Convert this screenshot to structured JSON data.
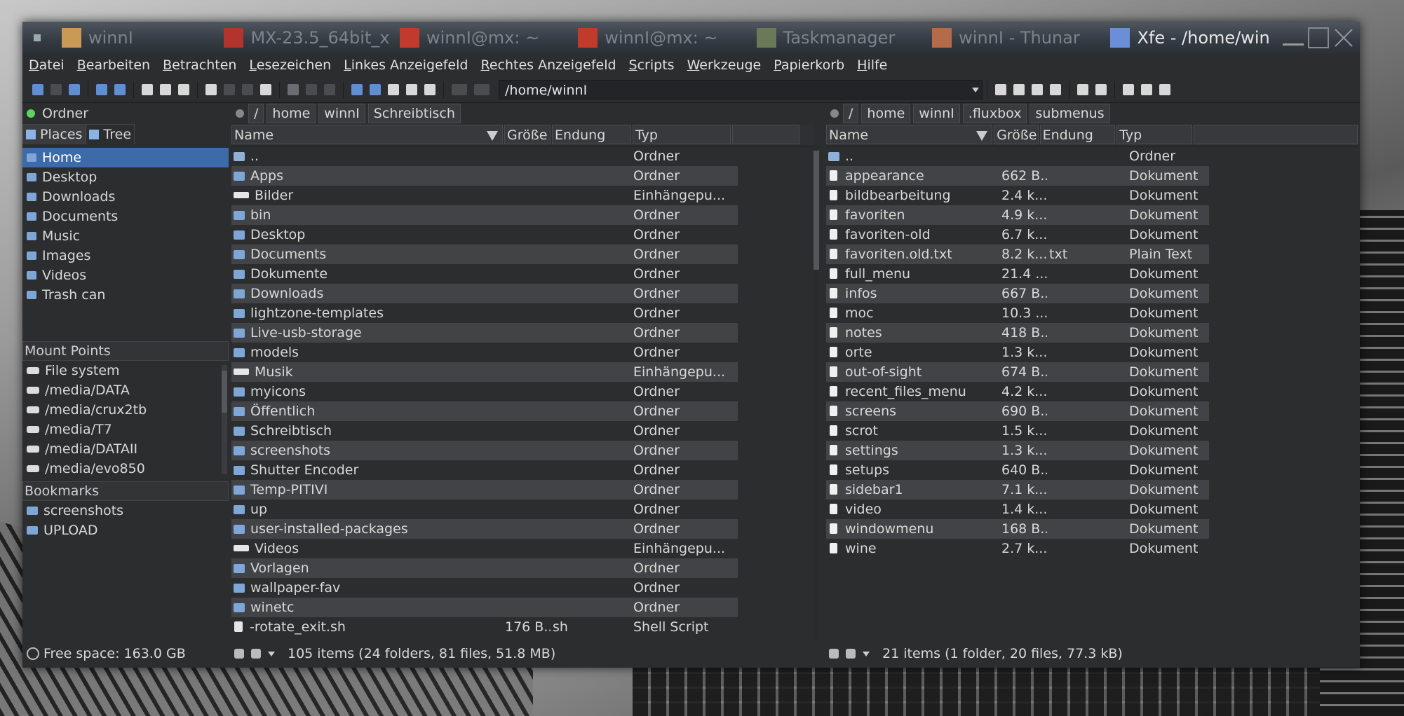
{
  "colors": {
    "accent": "#3d6aa8",
    "folder": "#7ea6d6",
    "window_bg": "#2c2d2f",
    "alt_row": "#424346"
  },
  "titlebar": {
    "tasks": [
      {
        "label": "winnI",
        "icon": "folder-icon"
      },
      {
        "label": "MX-23.5_64bit_x",
        "icon": "mx-logo-icon"
      },
      {
        "label": "winnI@mx: ~",
        "icon": "xterm-icon"
      },
      {
        "label": "winnI@mx: ~",
        "icon": "xterm-icon"
      },
      {
        "label": "Taskmanager",
        "icon": "monitor-icon"
      },
      {
        "label": "winnI - Thunar",
        "icon": "home-folder-icon"
      },
      {
        "label": "Xfe - /home/win",
        "icon": "xfe-icon"
      }
    ]
  },
  "menubar": [
    "Datei",
    "Bearbeiten",
    "Betrachten",
    "Lesezeichen",
    "Linkes Anzeigefeld",
    "Rechtes Anzeigefeld",
    "Scripts",
    "Werkzeuge",
    "Papierkorb",
    "Hilfe"
  ],
  "toolbar": {
    "path": "/home/winnI"
  },
  "sidebar": {
    "header": "Ordner",
    "tabs": [
      "Places",
      "Tree"
    ],
    "places": [
      "Home",
      "Desktop",
      "Downloads",
      "Documents",
      "Music",
      "Images",
      "Videos",
      "Trash can"
    ],
    "mount_points_title": "Mount Points",
    "mounts": [
      "File system",
      "/media/DATA",
      "/media/crux2tb",
      "/media/T7",
      "/media/DATAII",
      "/media/evo850"
    ],
    "bookmarks_title": "Bookmarks",
    "bookmarks": [
      "screenshots",
      "UPLOAD"
    ],
    "free_space": "Free space: 163.0 GB"
  },
  "left_panel": {
    "breadcrumb": [
      "/",
      "home",
      "winnI",
      "Schreibtisch"
    ],
    "columns": [
      "Name",
      "Größe",
      "Endung",
      "Typ"
    ],
    "rows": [
      {
        "name": "..",
        "size": "",
        "ext": "",
        "type": "Ordner",
        "icon": "up"
      },
      {
        "name": "Apps",
        "size": "",
        "ext": "",
        "type": "Ordner",
        "icon": "folder"
      },
      {
        "name": "Bilder",
        "size": "",
        "ext": "",
        "type": "Einhängepu...",
        "icon": "mount"
      },
      {
        "name": "bin",
        "size": "",
        "ext": "",
        "type": "Ordner",
        "icon": "folder"
      },
      {
        "name": "Desktop",
        "size": "",
        "ext": "",
        "type": "Ordner",
        "icon": "folder"
      },
      {
        "name": "Documents",
        "size": "",
        "ext": "",
        "type": "Ordner",
        "icon": "folder"
      },
      {
        "name": "Dokumente",
        "size": "",
        "ext": "",
        "type": "Ordner",
        "icon": "folder"
      },
      {
        "name": "Downloads",
        "size": "",
        "ext": "",
        "type": "Ordner",
        "icon": "folder"
      },
      {
        "name": "lightzone-templates",
        "size": "",
        "ext": "",
        "type": "Ordner",
        "icon": "folder"
      },
      {
        "name": "Live-usb-storage",
        "size": "",
        "ext": "",
        "type": "Ordner",
        "icon": "folder"
      },
      {
        "name": "models",
        "size": "",
        "ext": "",
        "type": "Ordner",
        "icon": "folder"
      },
      {
        "name": "Musik",
        "size": "",
        "ext": "",
        "type": "Einhängepu...",
        "icon": "mount"
      },
      {
        "name": "myicons",
        "size": "",
        "ext": "",
        "type": "Ordner",
        "icon": "folder"
      },
      {
        "name": "Öffentlich",
        "size": "",
        "ext": "",
        "type": "Ordner",
        "icon": "folder"
      },
      {
        "name": "Schreibtisch",
        "size": "",
        "ext": "",
        "type": "Ordner",
        "icon": "folder"
      },
      {
        "name": "screenshots",
        "size": "",
        "ext": "",
        "type": "Ordner",
        "icon": "folder"
      },
      {
        "name": "Shutter Encoder",
        "size": "",
        "ext": "",
        "type": "Ordner",
        "icon": "folder"
      },
      {
        "name": "Temp-PITIVI",
        "size": "",
        "ext": "",
        "type": "Ordner",
        "icon": "folder"
      },
      {
        "name": "up",
        "size": "",
        "ext": "",
        "type": "Ordner",
        "icon": "folder"
      },
      {
        "name": "user-installed-packages",
        "size": "",
        "ext": "",
        "type": "Ordner",
        "icon": "folder"
      },
      {
        "name": "Videos",
        "size": "",
        "ext": "",
        "type": "Einhängepu...",
        "icon": "mount"
      },
      {
        "name": "Vorlagen",
        "size": "",
        "ext": "",
        "type": "Ordner",
        "icon": "folder"
      },
      {
        "name": "wallpaper-fav",
        "size": "",
        "ext": "",
        "type": "Ordner",
        "icon": "folder"
      },
      {
        "name": "winetc",
        "size": "",
        "ext": "",
        "type": "Ordner",
        "icon": "folder"
      },
      {
        "name": "-rotate_exit.sh",
        "size": "176 B...",
        "ext": "sh",
        "type": "Shell Script",
        "icon": "script"
      }
    ],
    "status": "105 items (24 folders, 81 files, 51.8 MB)"
  },
  "right_panel": {
    "breadcrumb": [
      "/",
      "home",
      "winnI",
      ".fluxbox",
      "submenus"
    ],
    "columns": [
      "Name",
      "Größe",
      "Endung",
      "Typ"
    ],
    "rows": [
      {
        "name": "..",
        "size": "",
        "ext": "",
        "type": "Ordner",
        "icon": "up"
      },
      {
        "name": "appearance",
        "size": "662 B...",
        "ext": "",
        "type": "Dokument",
        "icon": "doc"
      },
      {
        "name": "bildbearbeitung",
        "size": "2.4 k...",
        "ext": "",
        "type": "Dokument",
        "icon": "doc"
      },
      {
        "name": "favoriten",
        "size": "4.9 k...",
        "ext": "",
        "type": "Dokument",
        "icon": "doc"
      },
      {
        "name": "favoriten-old",
        "size": "6.7 k...",
        "ext": "",
        "type": "Dokument",
        "icon": "doc"
      },
      {
        "name": "favoriten.old.txt",
        "size": "8.2 k...",
        "ext": "txt",
        "type": "Plain Text",
        "icon": "doc"
      },
      {
        "name": "full_menu",
        "size": "21.4 ...",
        "ext": "",
        "type": "Dokument",
        "icon": "doc"
      },
      {
        "name": "infos",
        "size": "667 B...",
        "ext": "",
        "type": "Dokument",
        "icon": "doc"
      },
      {
        "name": "moc",
        "size": "10.3 ...",
        "ext": "",
        "type": "Dokument",
        "icon": "doc"
      },
      {
        "name": "notes",
        "size": "418 B...",
        "ext": "",
        "type": "Dokument",
        "icon": "doc"
      },
      {
        "name": "orte",
        "size": "1.3 k...",
        "ext": "",
        "type": "Dokument",
        "icon": "doc"
      },
      {
        "name": "out-of-sight",
        "size": "674 B...",
        "ext": "",
        "type": "Dokument",
        "icon": "doc"
      },
      {
        "name": "recent_files_menu",
        "size": "4.2 k...",
        "ext": "",
        "type": "Dokument",
        "icon": "doc"
      },
      {
        "name": "screens",
        "size": "690 B...",
        "ext": "",
        "type": "Dokument",
        "icon": "doc"
      },
      {
        "name": "scrot",
        "size": "1.5 k...",
        "ext": "",
        "type": "Dokument",
        "icon": "doc"
      },
      {
        "name": "settings",
        "size": "1.3 k...",
        "ext": "",
        "type": "Dokument",
        "icon": "doc"
      },
      {
        "name": "setups",
        "size": "640 B...",
        "ext": "",
        "type": "Dokument",
        "icon": "doc"
      },
      {
        "name": "sidebar1",
        "size": "7.1 k...",
        "ext": "",
        "type": "Dokument",
        "icon": "doc"
      },
      {
        "name": "video",
        "size": "1.4 k...",
        "ext": "",
        "type": "Dokument",
        "icon": "doc"
      },
      {
        "name": "windowmenu",
        "size": "168 B...",
        "ext": "",
        "type": "Dokument",
        "icon": "doc"
      },
      {
        "name": "wine",
        "size": "2.7 k...",
        "ext": "",
        "type": "Dokument",
        "icon": "doc"
      }
    ],
    "status": "21 items (1 folder, 20 files, 77.3 kB)"
  }
}
